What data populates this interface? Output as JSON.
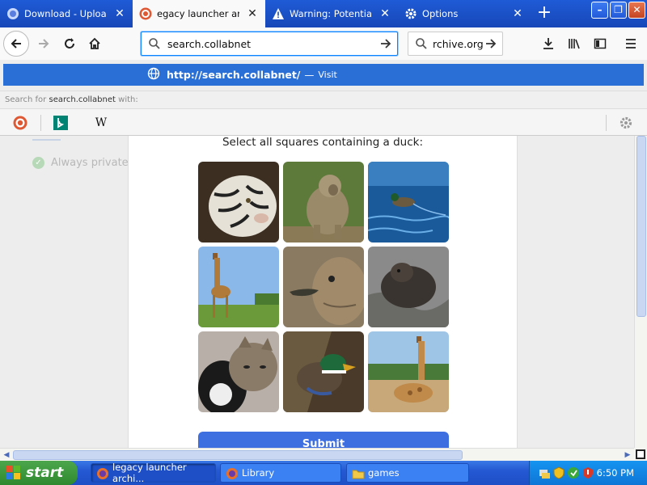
{
  "browser": {
    "tabs": [
      {
        "label": "Download - UploadNo",
        "icon": "uploadnow-icon",
        "active": false
      },
      {
        "label": "egacy launcher archi",
        "icon": "duckduckgo-icon",
        "active": true
      },
      {
        "label": "Warning: Potential Se",
        "icon": "warning-icon",
        "active": false
      },
      {
        "label": "Options",
        "icon": "gear-icon",
        "active": false
      }
    ],
    "url_value": "search.collabnet",
    "search_value": "rchive.org"
  },
  "autocomplete": {
    "url": "http://search.collabnet/",
    "dash": "—",
    "visit": "Visit",
    "hint_prefix": "Search for",
    "hint_query": "search.collabnet",
    "hint_suffix": "with:",
    "engines": [
      "duckduckgo-icon",
      "bing-icon",
      "wikipedia-icon"
    ],
    "wikipedia_label": "W"
  },
  "page": {
    "ghost_text": "Always private",
    "captcha_title": "Select all squares containing a duck:",
    "tiles": [
      "tiger",
      "baboon",
      "duck-swimming",
      "giraffe",
      "duck-head",
      "seal",
      "cat",
      "mallard",
      "giraffe-resting"
    ],
    "submit_label": "Submit"
  },
  "taskbar": {
    "start_label": "start",
    "tasks": [
      {
        "label": "legacy launcher archi...",
        "active": true
      },
      {
        "label": "Library",
        "active": false
      },
      {
        "label": "games",
        "active": false
      }
    ],
    "clock": "6:50 PM"
  },
  "colors": {
    "titlebar": "#1f5bd6",
    "accent": "#0a84ff",
    "autocomplete_highlight": "#2a6fd6",
    "submit": "#3e6fe0",
    "taskbar": "#2458d3",
    "start": "#3a963a"
  }
}
